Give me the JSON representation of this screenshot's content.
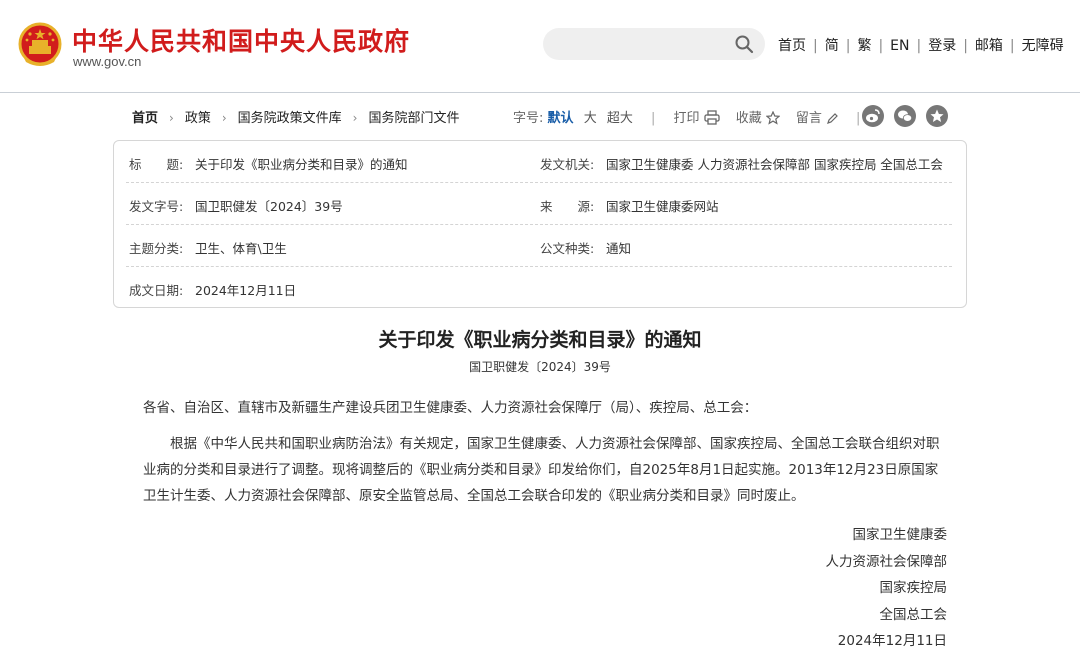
{
  "header": {
    "site_title": "中华人民共和国中央人民政府",
    "site_domain": "www.gov.cn",
    "search": {
      "placeholder": "",
      "icon": "search-icon"
    },
    "nav": [
      {
        "label": "首页"
      },
      {
        "label": "简"
      },
      {
        "label": "繁"
      },
      {
        "label": "EN"
      },
      {
        "label": "登录"
      },
      {
        "label": "邮箱"
      },
      {
        "label": "无障碍"
      }
    ]
  },
  "breadcrumb": {
    "items": [
      {
        "label": "首页"
      },
      {
        "label": "政策"
      },
      {
        "label": "国务院政策文件库"
      },
      {
        "label": "国务院部门文件"
      }
    ],
    "separator": "›"
  },
  "tools": {
    "font_size_label": "字号:",
    "font_sizes": {
      "default": "默认",
      "large": "大",
      "xlarge": "超大"
    },
    "print": "打印",
    "favorite": "收藏",
    "comment": "留言",
    "divider": "|"
  },
  "info": {
    "title_label": "标　　题:",
    "title_value": "关于印发《职业病分类和目录》的通知",
    "issuer_label": "发文机关:",
    "issuer_value": "国家卫生健康委  人力资源社会保障部  国家疾控局  全国总工会",
    "docno_label": "发文字号:",
    "docno_value": "国卫职健发〔2024〕39号",
    "source_label": "来　　源:",
    "source_value": "国家卫生健康委网站",
    "topic_label": "主题分类:",
    "topic_value": "卫生、体育\\卫生",
    "type_label": "公文种类:",
    "type_value": "通知",
    "date_label": "成文日期:",
    "date_value": "2024年12月11日"
  },
  "article": {
    "title": "关于印发《职业病分类和目录》的通知",
    "doc_number": "国卫职健发〔2024〕39号",
    "salutation": "各省、自治区、直辖市及新疆生产建设兵团卫生健康委、人力资源社会保障厅（局）、疾控局、总工会：",
    "body": "根据《中华人民共和国职业病防治法》有关规定，国家卫生健康委、人力资源社会保障部、国家疾控局、全国总工会联合组织对职业病的分类和目录进行了调整。现将调整后的《职业病分类和目录》印发给你们，自2025年8月1日起实施。2013年12月23日原国家卫生计生委、人力资源社会保障部、原安全监管总局、全国总工会联合印发的《职业病分类和目录》同时废止。",
    "signers": [
      "国家卫生健康委",
      "人力资源社会保障部",
      "国家疾控局",
      "全国总工会",
      "2024年12月11日"
    ]
  },
  "colors": {
    "brand_red": "#d11c1c",
    "link_blue": "#1a5ea8",
    "share_gray": "#777777"
  }
}
